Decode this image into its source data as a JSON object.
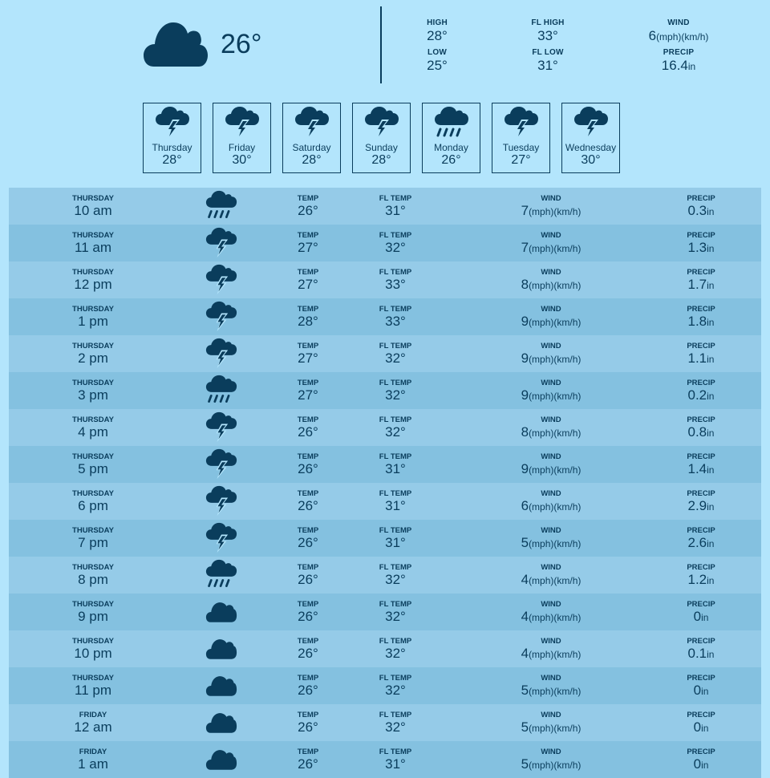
{
  "current": {
    "icon": "cloud-icon",
    "temperature": "26°",
    "stats": {
      "high_label": "HIGH",
      "high": "28°",
      "low_label": "LOW",
      "low": "25°",
      "fl_high_label": "FL HIGH",
      "fl_high": "33°",
      "fl_low_label": "FL LOW",
      "fl_low": "31°",
      "wind_label": "WIND",
      "wind_value": "6",
      "wind_unit": "(mph)(km/h)",
      "precip_label": "PRECIP",
      "precip_value": "16.4",
      "precip_unit": "in"
    }
  },
  "daily": [
    {
      "day": "Thursday",
      "temp": "28°",
      "icon": "thunderstorm-icon"
    },
    {
      "day": "Friday",
      "temp": "30°",
      "icon": "thunderstorm-icon"
    },
    {
      "day": "Saturday",
      "temp": "28°",
      "icon": "thunderstorm-icon"
    },
    {
      "day": "Sunday",
      "temp": "28°",
      "icon": "thunderstorm-icon"
    },
    {
      "day": "Monday",
      "temp": "26°",
      "icon": "rain-icon"
    },
    {
      "day": "Tuesday",
      "temp": "27°",
      "icon": "thunderstorm-icon"
    },
    {
      "day": "Wednesday",
      "temp": "30°",
      "icon": "thunderstorm-icon"
    }
  ],
  "hourly_labels": {
    "temp": "TEMP",
    "fl_temp": "FL TEMP",
    "wind": "WIND",
    "precip": "PRECIP",
    "wind_unit": "(mph)(km/h)",
    "precip_unit": "in"
  },
  "hourly": [
    {
      "day": "THURSDAY",
      "time": "10 am",
      "icon": "rain-icon",
      "temp": "26°",
      "fl": "31°",
      "wind": "7",
      "precip": "0.3"
    },
    {
      "day": "THURSDAY",
      "time": "11 am",
      "icon": "thunderstorm-icon",
      "temp": "27°",
      "fl": "32°",
      "wind": "7",
      "precip": "1.3"
    },
    {
      "day": "THURSDAY",
      "time": "12 pm",
      "icon": "thunderstorm-icon",
      "temp": "27°",
      "fl": "33°",
      "wind": "8",
      "precip": "1.7"
    },
    {
      "day": "THURSDAY",
      "time": "1 pm",
      "icon": "thunderstorm-icon",
      "temp": "28°",
      "fl": "33°",
      "wind": "9",
      "precip": "1.8"
    },
    {
      "day": "THURSDAY",
      "time": "2 pm",
      "icon": "thunderstorm-icon",
      "temp": "27°",
      "fl": "32°",
      "wind": "9",
      "precip": "1.1"
    },
    {
      "day": "THURSDAY",
      "time": "3 pm",
      "icon": "rain-icon",
      "temp": "27°",
      "fl": "32°",
      "wind": "9",
      "precip": "0.2"
    },
    {
      "day": "THURSDAY",
      "time": "4 pm",
      "icon": "thunderstorm-icon",
      "temp": "26°",
      "fl": "32°",
      "wind": "8",
      "precip": "0.8"
    },
    {
      "day": "THURSDAY",
      "time": "5 pm",
      "icon": "thunderstorm-icon",
      "temp": "26°",
      "fl": "31°",
      "wind": "9",
      "precip": "1.4"
    },
    {
      "day": "THURSDAY",
      "time": "6 pm",
      "icon": "thunderstorm-icon",
      "temp": "26°",
      "fl": "31°",
      "wind": "6",
      "precip": "2.9"
    },
    {
      "day": "THURSDAY",
      "time": "7 pm",
      "icon": "thunderstorm-icon",
      "temp": "26°",
      "fl": "31°",
      "wind": "5",
      "precip": "2.6"
    },
    {
      "day": "THURSDAY",
      "time": "8 pm",
      "icon": "rain-icon",
      "temp": "26°",
      "fl": "32°",
      "wind": "4",
      "precip": "1.2"
    },
    {
      "day": "THURSDAY",
      "time": "9 pm",
      "icon": "cloud-icon",
      "temp": "26°",
      "fl": "32°",
      "wind": "4",
      "precip": "0"
    },
    {
      "day": "THURSDAY",
      "time": "10 pm",
      "icon": "cloud-icon",
      "temp": "26°",
      "fl": "32°",
      "wind": "4",
      "precip": "0.1"
    },
    {
      "day": "THURSDAY",
      "time": "11 pm",
      "icon": "cloud-icon",
      "temp": "26°",
      "fl": "32°",
      "wind": "5",
      "precip": "0"
    },
    {
      "day": "FRIDAY",
      "time": "12 am",
      "icon": "cloud-icon",
      "temp": "26°",
      "fl": "32°",
      "wind": "5",
      "precip": "0"
    },
    {
      "day": "FRIDAY",
      "time": "1 am",
      "icon": "cloud-icon",
      "temp": "26°",
      "fl": "31°",
      "wind": "5",
      "precip": "0"
    }
  ],
  "colors": {
    "background": "#b3e5fc",
    "ink": "#0a3d5c",
    "row_light": "#95cbe8",
    "row_dark": "#84c1e0"
  }
}
